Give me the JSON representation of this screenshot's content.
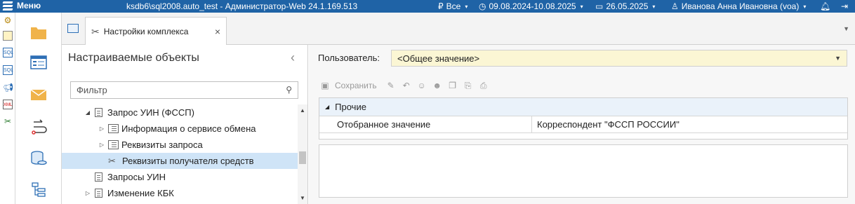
{
  "titlebar": {
    "menu_label": "Меню",
    "title": "ksdb6\\sql2008.auto_test - Администратор-Web 24.1.169.513",
    "filter_icon": "ruble-icon",
    "filter_value": "Все",
    "period": "09.08.2024-10.08.2025",
    "date": "26.05.2025",
    "user": "Иванова Анна Ивановна (voa)"
  },
  "tab": {
    "label": "Настройки комплекса",
    "close": "×"
  },
  "left_panel": {
    "title": "Настраиваемые объекты",
    "filter_placeholder": "Фильтр",
    "tree": [
      {
        "label": "Запрос УИН (ФССП)",
        "expander": "◢",
        "icon": "document-icon",
        "selected": false
      },
      {
        "label": "Информация о сервисе обмена",
        "expander": "▷",
        "icon": "list-icon",
        "selected": false
      },
      {
        "label": "Реквизиты запроса",
        "expander": "▷",
        "icon": "list-icon",
        "selected": false
      },
      {
        "label": "Реквизиты получателя средств",
        "expander": "",
        "icon": "tools-icon",
        "selected": true
      },
      {
        "label": "Запросы УИН",
        "expander": "",
        "icon": "document-icon",
        "selected": false
      },
      {
        "label": "Изменение КБК",
        "expander": "▷",
        "icon": "document-icon",
        "selected": false
      }
    ]
  },
  "right_panel": {
    "user_label": "Пользователь:",
    "user_value": "<Общее значение>",
    "toolbar": {
      "save_label": "Сохранить"
    },
    "grid": {
      "group": "Прочие",
      "rows": [
        {
          "name": "Отобранное значение",
          "value": "Корреспондент \"ФССП РОССИИ\""
        }
      ]
    }
  },
  "colors": {
    "titlebar": "#1f63a6",
    "selection": "#cfe4f7",
    "user_field": "#fbf6d4",
    "group_row": "#eaf2fa"
  }
}
